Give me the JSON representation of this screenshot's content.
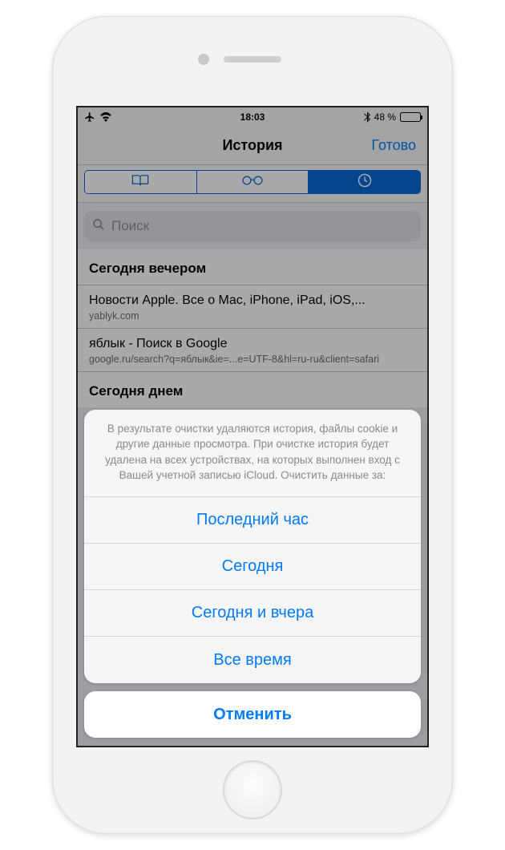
{
  "status": {
    "time": "18:03",
    "battery_pct": "48 %",
    "bluetooth_icon": "bluetooth",
    "airplane_icon": "airplane",
    "wifi_icon": "wifi"
  },
  "nav": {
    "title": "История",
    "done": "Готово"
  },
  "segments": {
    "bookmarks_icon": "book",
    "readinglist_icon": "glasses",
    "history_icon": "clock"
  },
  "search": {
    "placeholder": "Поиск",
    "icon": "search"
  },
  "history": {
    "section0_header": "Сегодня вечером",
    "section1_header": "Сегодня днем",
    "rows": [
      {
        "title": "Новости Apple. Все о Mac, iPhone, iPad, iOS,...",
        "sub": "yablyk.com"
      },
      {
        "title": "яблык - Поиск в Google",
        "sub": "google.ru/search?q=яблык&ie=...e=UTF-8&hl=ru-ru&client=safari"
      }
    ]
  },
  "sheet": {
    "message": "В результате очистки удаляются история, файлы cookie и другие данные просмотра. При очистке история будет удалена на всех устройствах, на которых выполнен вход с Вашей учетной записью iCloud. Очистить данные за:",
    "options": [
      "Последний час",
      "Сегодня",
      "Сегодня и вчера",
      "Все время"
    ],
    "cancel": "Отменить"
  }
}
